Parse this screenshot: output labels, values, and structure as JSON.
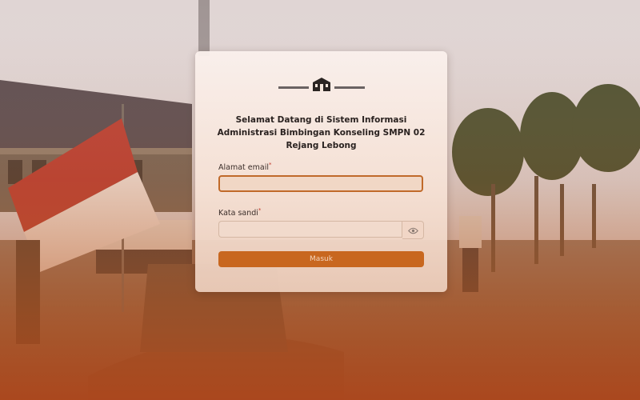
{
  "login": {
    "title": "Selamat Datang di Sistem Informasi Administrasi Bimbingan Konseling SMPN 02 Rejang Lebong",
    "email_label": "Alamat email",
    "email_value": "",
    "password_label": "Kata sandi",
    "password_value": "",
    "required_mark": "*",
    "submit_label": "Masuk",
    "logo_icon": "school-building-icon",
    "toggle_icon": "eye-icon"
  },
  "colors": {
    "accent": "#c8671f",
    "focus_border": "#c06a2a",
    "overlay_bottom": "#b9531a"
  }
}
